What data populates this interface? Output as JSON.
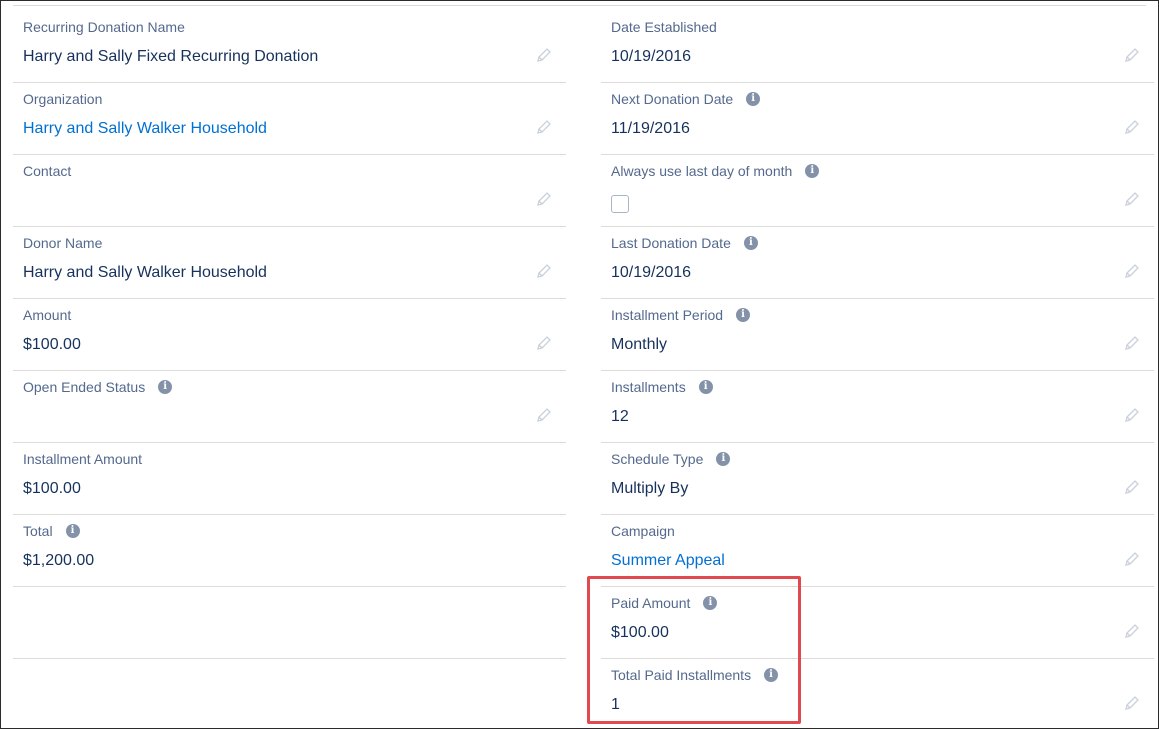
{
  "left_fields": [
    {
      "label": "Recurring Donation Name",
      "value": "Harry and Sally Fixed Recurring Donation",
      "info": false,
      "link": false
    },
    {
      "label": "Organization",
      "value": "Harry and Sally Walker Household",
      "info": false,
      "link": true
    },
    {
      "label": "Contact",
      "value": "",
      "info": false,
      "link": false
    },
    {
      "label": "Donor Name",
      "value": "Harry and Sally Walker Household",
      "info": false,
      "link": false
    },
    {
      "label": "Amount",
      "value": "$100.00",
      "info": false,
      "link": false
    },
    {
      "label": "Open Ended Status",
      "value": "",
      "info": true,
      "link": false
    },
    {
      "label": "Installment Amount",
      "value": "$100.00",
      "info": false,
      "link": false
    },
    {
      "label": "Total",
      "value": "$1,200.00",
      "info": true,
      "link": false
    }
  ],
  "right_fields": [
    {
      "label": "Date Established",
      "value": "10/19/2016",
      "info": false,
      "link": false
    },
    {
      "label": "Next Donation Date",
      "value": "11/19/2016",
      "info": true,
      "link": false
    },
    {
      "label": "Always use last day of month",
      "value": "",
      "info": true,
      "checkbox": true,
      "checked": false
    },
    {
      "label": "Last Donation Date",
      "value": "10/19/2016",
      "info": true,
      "link": false
    },
    {
      "label": "Installment Period",
      "value": "Monthly",
      "info": true,
      "link": false
    },
    {
      "label": "Installments",
      "value": "12",
      "info": true,
      "link": false
    },
    {
      "label": "Schedule Type",
      "value": "Multiply By",
      "info": true,
      "link": false
    },
    {
      "label": "Campaign",
      "value": "Summer Appeal",
      "info": false,
      "link": true
    },
    {
      "label": "Paid Amount",
      "value": "$100.00",
      "info": true,
      "link": false
    },
    {
      "label": "Total Paid Installments",
      "value": "1",
      "info": true,
      "link": false
    }
  ],
  "icons": {
    "info": "info-icon",
    "edit": "pencil-icon"
  },
  "colors": {
    "label": "#54698d",
    "value": "#16325c",
    "link": "#0070d2",
    "highlight": "#e04a4f"
  }
}
